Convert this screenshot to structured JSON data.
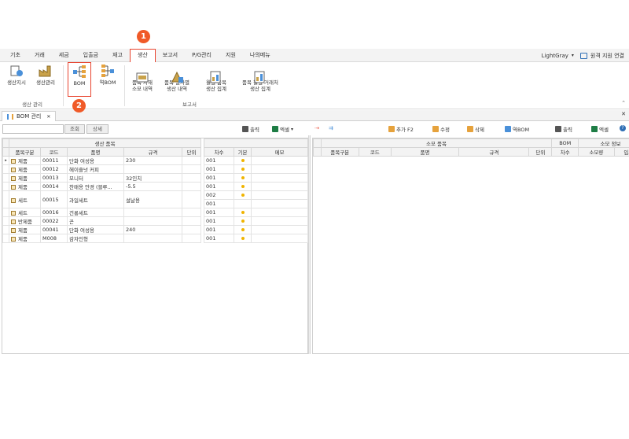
{
  "menu": {
    "items": [
      "기초",
      "거래",
      "세금",
      "입출금",
      "재고",
      "생산",
      "보고서",
      "P/G관리",
      "지원",
      "나의메뉴"
    ],
    "active_index": 5,
    "theme": "LightGray",
    "theme_arrow": "▾",
    "remote": "원격 지원 연결"
  },
  "badges": {
    "one": "1",
    "two": "2"
  },
  "ribbon": {
    "buttons": [
      "생산지시",
      "생산관리",
      "BOM",
      "역BOM",
      "품목 자재\n소모 내역",
      "품목 일자별\n생산 내역",
      "월별 품목\n생산 집계",
      "품목 월별 거래처\n생산 집계"
    ],
    "groups": [
      "생산 관리",
      "보고서"
    ]
  },
  "doc_tab": {
    "label": "BOM 관리",
    "close": "✕"
  },
  "toolbar": {
    "search": "조회",
    "detail": "상세",
    "print": "출력",
    "excel": "엑셀",
    "add": "추가 F2",
    "edit": "수정",
    "delete": "삭제",
    "reverse_bom": "역BOM",
    "print2": "출력",
    "excel2": "엑셀"
  },
  "left_grid": {
    "group_header": "생산 품목",
    "headers": [
      "품목구분",
      "코드",
      "품명",
      "규격",
      "단위"
    ],
    "right_headers": [
      "차수",
      "기본",
      "메모"
    ],
    "rows": [
      {
        "type": "제품",
        "code": "00011",
        "name": "단화 여성용",
        "spec": "230",
        "unit": "",
        "deg": [
          "001"
        ],
        "basic": true
      },
      {
        "type": "제품",
        "code": "00012",
        "name": "헤이즐넛 커피",
        "spec": "",
        "unit": "",
        "deg": [
          "001"
        ],
        "basic": true
      },
      {
        "type": "제품",
        "code": "00013",
        "name": "모니터",
        "spec": "32인치",
        "unit": "",
        "deg": [
          "001"
        ],
        "basic": true
      },
      {
        "type": "제품",
        "code": "00014",
        "name": "찬매용 안경 (블루...",
        "spec": "-5.5",
        "unit": "",
        "deg": [
          "001"
        ],
        "basic": true
      },
      {
        "type": "세트",
        "code": "00015",
        "name": "과일세트",
        "spec": "설날용",
        "unit": "",
        "deg": [
          "002",
          "001"
        ],
        "basic": true
      },
      {
        "type": "세트",
        "code": "00016",
        "name": "건룡세트",
        "spec": "",
        "unit": "",
        "deg": [
          "001"
        ],
        "basic": true
      },
      {
        "type": "반제품",
        "code": "00022",
        "name": "끈",
        "spec": "",
        "unit": "",
        "deg": [
          "001"
        ],
        "basic": true
      },
      {
        "type": "제품",
        "code": "00041",
        "name": "단화 여성용",
        "spec": "240",
        "unit": "",
        "deg": [
          "001"
        ],
        "basic": true
      },
      {
        "type": "제품",
        "code": "M008",
        "name": "감자인형",
        "spec": "",
        "unit": "",
        "deg": [
          "001"
        ],
        "basic": true
      }
    ]
  },
  "right_grid": {
    "group_headers": [
      "소모 품목",
      "BOM",
      "소모 정보"
    ],
    "headers": [
      "품목구분",
      "코드",
      "품명",
      "규격",
      "단위",
      "차수",
      "소모량",
      "입고"
    ]
  },
  "colors": {
    "accent": "#e8432e",
    "badge": "#f05a28",
    "dot": "#f0b400"
  }
}
